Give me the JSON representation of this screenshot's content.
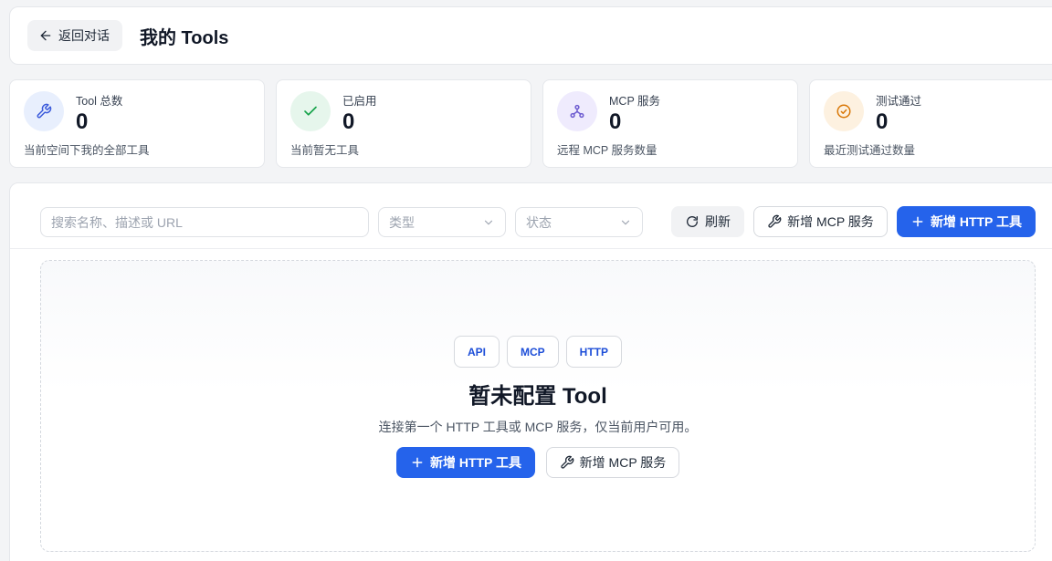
{
  "header": {
    "back_label": "返回对话",
    "title": "我的 Tools"
  },
  "stats": [
    {
      "label": "Tool 总数",
      "value": "0",
      "desc": "当前空间下我的全部工具",
      "icon": "wrench-icon",
      "color": "#3b5bdb",
      "bg": "#e8effd"
    },
    {
      "label": "已启用",
      "value": "0",
      "desc": "当前暂无工具",
      "icon": "check-icon",
      "color": "#16a34a",
      "bg": "#e6f6ec"
    },
    {
      "label": "MCP 服务",
      "value": "0",
      "desc": "远程 MCP 服务数量",
      "icon": "network-icon",
      "color": "#6d5bd0",
      "bg": "#efebfd"
    },
    {
      "label": "测试通过",
      "value": "0",
      "desc": "最近测试通过数量",
      "icon": "check-circle-icon",
      "color": "#d97706",
      "bg": "#fdf1e0"
    }
  ],
  "toolbar": {
    "search_placeholder": "搜索名称、描述或 URL",
    "type_placeholder": "类型",
    "status_placeholder": "状态",
    "refresh_label": "刷新",
    "add_mcp_label": "新增 MCP 服务",
    "add_http_label": "新增 HTTP 工具"
  },
  "empty": {
    "chips": [
      "API",
      "MCP",
      "HTTP"
    ],
    "title": "暂未配置 Tool",
    "desc": "连接第一个 HTTP 工具或 MCP 服务，仅当前用户可用。",
    "add_http_label": "新增 HTTP 工具",
    "add_mcp_label": "新增 MCP 服务"
  },
  "colors": {
    "primary": "#2563eb",
    "chip_text": "#1d4ed8"
  }
}
